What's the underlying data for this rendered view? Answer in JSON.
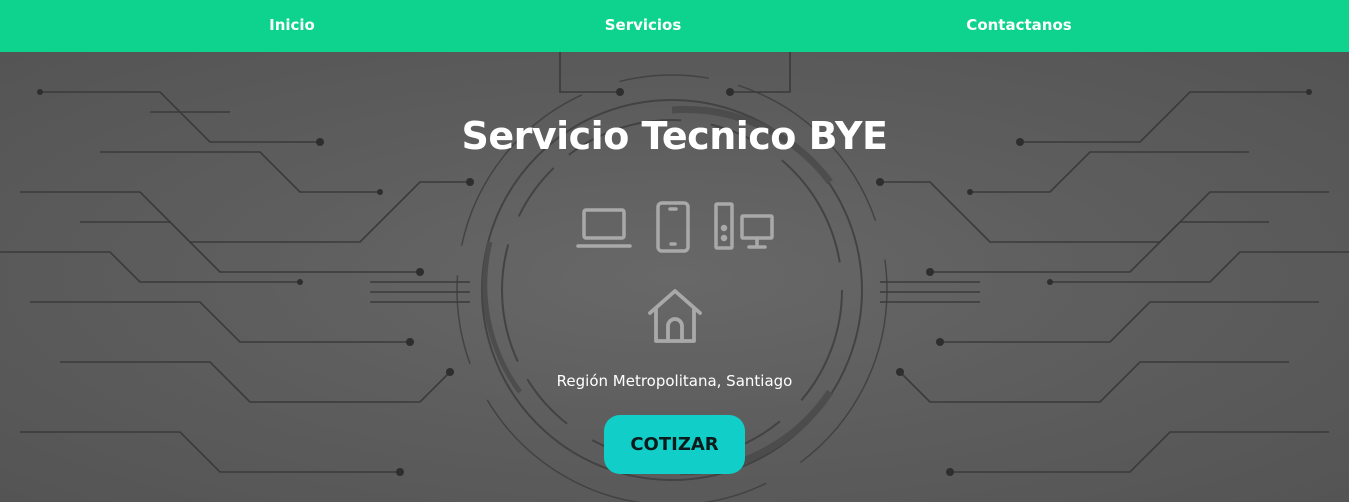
{
  "nav": {
    "items": [
      {
        "label": "Inicio"
      },
      {
        "label": "Servicios"
      },
      {
        "label": "Contactanos"
      }
    ],
    "background_color": "#0dd38f"
  },
  "hero": {
    "title": "Servicio Tecnico BYE",
    "icons": [
      "laptop-icon",
      "smartphone-icon",
      "desktop-computer-icon",
      "home-icon"
    ],
    "location": "Región Metropolitana, Santiago",
    "cta_label": "COTIZAR",
    "cta_color": "#11cfc8"
  }
}
